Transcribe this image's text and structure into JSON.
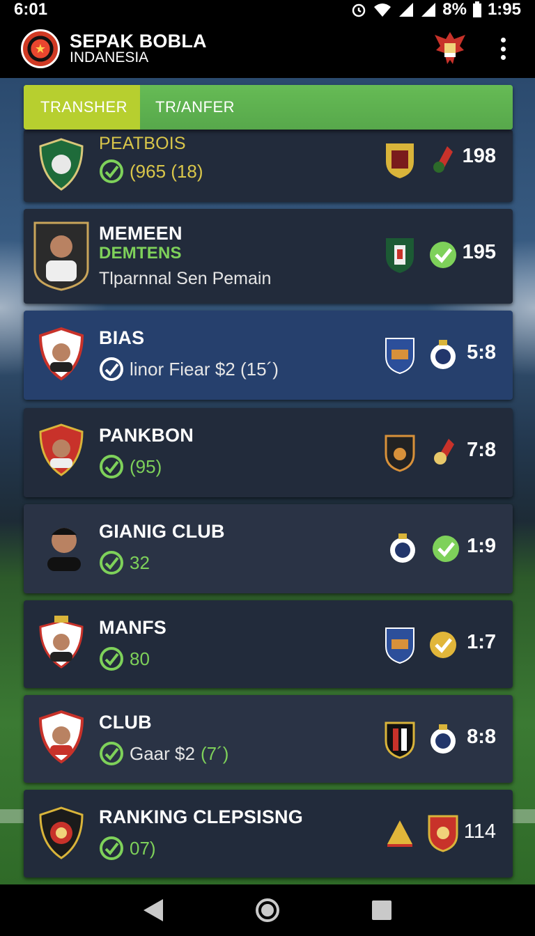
{
  "status_bar": {
    "left_time": "6:01",
    "battery": "8%",
    "right_time": "1:95"
  },
  "app": {
    "title": "SEPAK BOBLA",
    "subtitle": "INDANESIA"
  },
  "tabs": [
    {
      "label": "TRANSHER",
      "active": true
    },
    {
      "label": "TR/ANFER",
      "active": false
    }
  ],
  "rows": [
    {
      "title": "PEATBOIS",
      "sub_text": "",
      "value": "(965 (18)",
      "score": "198",
      "title_color": "#d9c64a"
    },
    {
      "title": "MEMEEN",
      "title2": "DEMTENS",
      "sub_text": "Tlparnnal Sen Pemain",
      "value": "",
      "score": "195"
    },
    {
      "title": "BIAS",
      "sub_text": "linor Fiear $2 (15´)",
      "value": "",
      "score": "5:8"
    },
    {
      "title": "PANKBON",
      "sub_text": "",
      "value": "(95)",
      "score": "7:8"
    },
    {
      "title": "GIANIG CLUB",
      "sub_text": "",
      "value": "32",
      "score": "1:9"
    },
    {
      "title": "MANFS",
      "sub_text": "",
      "value": "80",
      "score": "1:7"
    },
    {
      "title": "CLUB",
      "sub_text": "Gaar $2",
      "value": "(7´)",
      "score": "8:8"
    },
    {
      "title": "RANKING CLEPSISNG",
      "sub_text": "",
      "value": "07)",
      "score": "114"
    }
  ],
  "colors": {
    "accent_green": "#7ed15a",
    "tab_active": "#b7cf2f",
    "tab_bar": "#5fb552",
    "row_bg": "#222b3b",
    "row_highlight": "#26406d"
  },
  "icons": [
    "wifi-icon",
    "signal-icon",
    "battery-icon",
    "alarm-icon",
    "garuda-emblem-icon",
    "more-vert-icon",
    "check-icon",
    "back-nav-icon",
    "home-nav-icon",
    "recents-nav-icon"
  ]
}
